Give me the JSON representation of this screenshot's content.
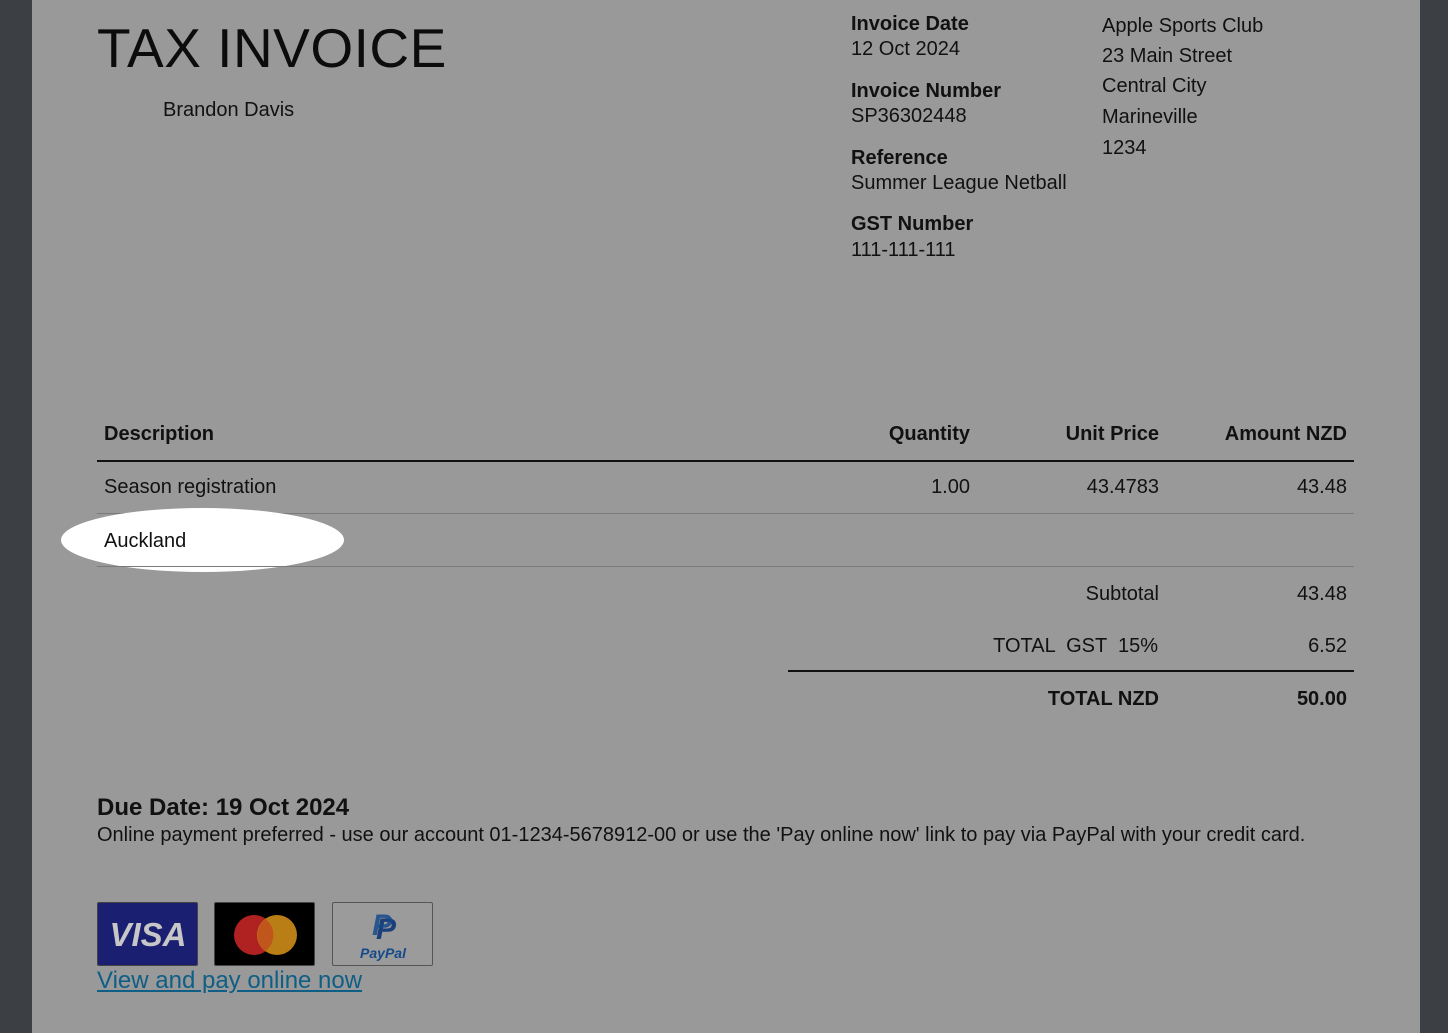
{
  "invoice": {
    "title": "TAX INVOICE",
    "recipient": "Brandon Davis",
    "meta": [
      {
        "label": "Invoice Date",
        "value": "12 Oct 2024"
      },
      {
        "label": "Invoice Number",
        "value": "SP36302448"
      },
      {
        "label": "Reference",
        "value": "Summer League Netball"
      },
      {
        "label": "GST Number",
        "value": "111-111-111"
      }
    ],
    "from_address": [
      "Apple Sports Club",
      "23 Main Street",
      "Central City",
      "Marineville",
      "1234"
    ]
  },
  "table": {
    "headers": {
      "description": "Description",
      "quantity": "Quantity",
      "unit_price": "Unit Price",
      "amount": "Amount NZD"
    },
    "rows": [
      {
        "description": "Season registration",
        "quantity": "1.00",
        "unit_price": "43.4783",
        "amount": "43.48"
      },
      {
        "description": "Auckland",
        "quantity": "",
        "unit_price": "",
        "amount": ""
      }
    ],
    "subtotal": {
      "label": "Subtotal",
      "value": "43.48"
    },
    "gst": {
      "label": "TOTAL  GST  15%",
      "value": "6.52"
    },
    "total": {
      "label": "TOTAL NZD",
      "value": "50.00"
    }
  },
  "payment": {
    "due": "Due Date: 19 Oct 2024",
    "note": "Online payment preferred - use our account 01-1234-5678912-00 or use the 'Pay online now' link to pay via PayPal with your credit card.",
    "cards": {
      "visa": "VISA",
      "paypal": "PayPal"
    },
    "link": "View and pay online now"
  },
  "colors": {
    "page": "#999999",
    "backdrop": "#3c3f43",
    "link": "#0e5e86",
    "visa": "#1a1f71"
  }
}
